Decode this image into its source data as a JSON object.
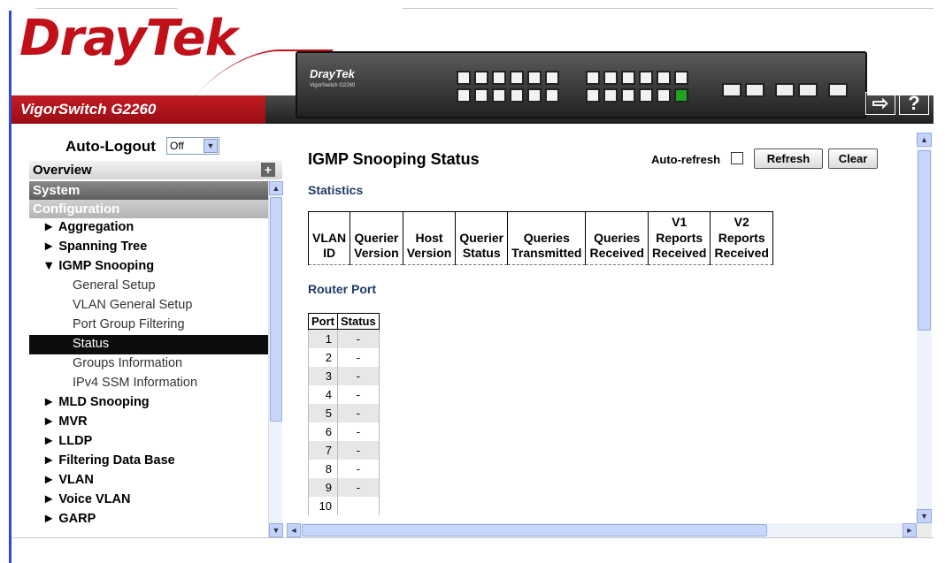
{
  "brand": {
    "logo": "DrayTek",
    "model": "VigorSwitch G2260",
    "device_brand": "DrayTek",
    "device_model": "VigorSwitch G2260"
  },
  "header_buttons": {
    "logout": "⇨",
    "help": "?"
  },
  "sidebar": {
    "auto_logout_label": "Auto-Logout",
    "auto_logout_value": "Off",
    "overview": "Overview",
    "system": "System",
    "configuration": "Configuration",
    "items": [
      {
        "label": "► Aggregation",
        "type": "item"
      },
      {
        "label": "► Spanning Tree",
        "type": "item"
      },
      {
        "label": "▼ IGMP Snooping",
        "type": "item"
      },
      {
        "label": "General Setup",
        "type": "sub"
      },
      {
        "label": "VLAN General Setup",
        "type": "sub"
      },
      {
        "label": "Port Group Filtering",
        "type": "sub"
      },
      {
        "label": "Status",
        "type": "sub",
        "active": true
      },
      {
        "label": "Groups Information",
        "type": "sub"
      },
      {
        "label": "IPv4 SSM Information",
        "type": "sub"
      },
      {
        "label": "► MLD Snooping",
        "type": "item"
      },
      {
        "label": "► MVR",
        "type": "item"
      },
      {
        "label": "► LLDP",
        "type": "item"
      },
      {
        "label": "► Filtering Data Base",
        "type": "item"
      },
      {
        "label": "► VLAN",
        "type": "item"
      },
      {
        "label": "► Voice VLAN",
        "type": "item"
      },
      {
        "label": "► GARP",
        "type": "item"
      }
    ]
  },
  "content": {
    "title": "IGMP Snooping Status",
    "auto_refresh_label": "Auto-refresh",
    "refresh_button": "Refresh",
    "clear_button": "Clear",
    "statistics_heading": "Statistics",
    "statistics_columns": [
      [
        "VLAN",
        "ID"
      ],
      [
        "Querier",
        "Version"
      ],
      [
        "Host",
        "Version"
      ],
      [
        "Querier",
        "Status"
      ],
      [
        "Queries",
        "Transmitted"
      ],
      [
        "Queries",
        "Received"
      ],
      [
        "V1",
        "Reports",
        "Received"
      ],
      [
        "V2",
        "Reports",
        "Received"
      ]
    ],
    "router_port_heading": "Router Port",
    "router_port_columns": [
      "Port",
      "Status"
    ],
    "router_ports": [
      {
        "port": "1",
        "status": "-"
      },
      {
        "port": "2",
        "status": "-"
      },
      {
        "port": "3",
        "status": "-"
      },
      {
        "port": "4",
        "status": "-"
      },
      {
        "port": "5",
        "status": "-"
      },
      {
        "port": "6",
        "status": "-"
      },
      {
        "port": "7",
        "status": "-"
      },
      {
        "port": "8",
        "status": "-"
      },
      {
        "port": "9",
        "status": "-"
      },
      {
        "port": "10",
        "status": ""
      }
    ]
  },
  "colors": {
    "brand_red": "#c0111b",
    "frame_blue": "#2b4bd6",
    "heading_blue": "#1f3b68"
  }
}
